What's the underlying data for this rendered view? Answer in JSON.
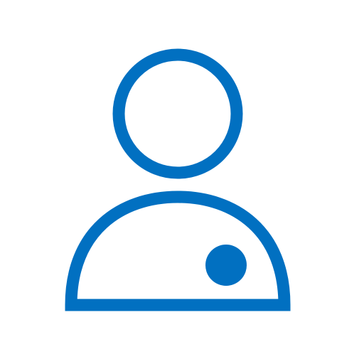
{
  "icon": {
    "name": "user-icon",
    "color": "#0170c1",
    "background": "#ffffff",
    "parts": [
      "head-circle",
      "body-dome",
      "status-dot"
    ]
  }
}
